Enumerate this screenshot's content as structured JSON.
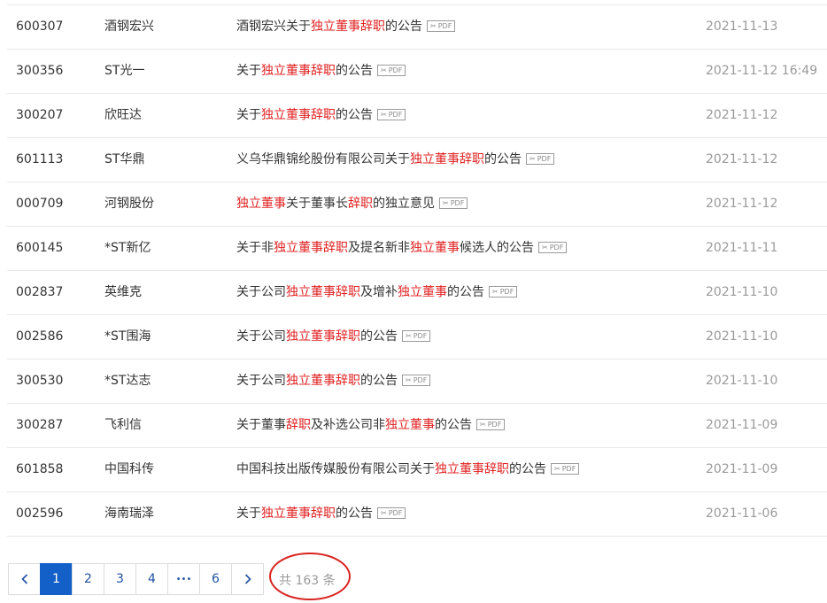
{
  "announcements": [
    {
      "code": "600307",
      "name": "酒钢宏兴",
      "title_parts": [
        {
          "t": "酒钢宏兴关于",
          "h": false
        },
        {
          "t": "独立董事辞职",
          "h": true
        },
        {
          "t": "的公告",
          "h": false
        }
      ],
      "date": "2021-11-13"
    },
    {
      "code": "300356",
      "name": "ST光一",
      "title_parts": [
        {
          "t": "关于",
          "h": false
        },
        {
          "t": "独立董事辞职",
          "h": true
        },
        {
          "t": "的公告",
          "h": false
        }
      ],
      "date": "2021-11-12 16:49"
    },
    {
      "code": "300207",
      "name": "欣旺达",
      "title_parts": [
        {
          "t": "关于",
          "h": false
        },
        {
          "t": "独立董事辞职",
          "h": true
        },
        {
          "t": "的公告",
          "h": false
        }
      ],
      "date": "2021-11-12"
    },
    {
      "code": "601113",
      "name": "ST华鼎",
      "title_parts": [
        {
          "t": "义乌华鼎锦纶股份有限公司关于",
          "h": false
        },
        {
          "t": "独立董事辞职",
          "h": true
        },
        {
          "t": "的公告",
          "h": false
        }
      ],
      "date": "2021-11-12"
    },
    {
      "code": "000709",
      "name": "河钢股份",
      "title_parts": [
        {
          "t": "独立董事",
          "h": true
        },
        {
          "t": "关于董事长",
          "h": false
        },
        {
          "t": "辞职",
          "h": true
        },
        {
          "t": "的独立意见",
          "h": false
        }
      ],
      "date": "2021-11-12"
    },
    {
      "code": "600145",
      "name": "*ST新亿",
      "title_parts": [
        {
          "t": "关于非",
          "h": false
        },
        {
          "t": "独立董事辞职",
          "h": true
        },
        {
          "t": "及提名新非",
          "h": false
        },
        {
          "t": "独立董事",
          "h": true
        },
        {
          "t": "候选人的公告",
          "h": false
        }
      ],
      "date": "2021-11-11"
    },
    {
      "code": "002837",
      "name": "英维克",
      "title_parts": [
        {
          "t": "关于公司",
          "h": false
        },
        {
          "t": "独立董事辞职",
          "h": true
        },
        {
          "t": "及增补",
          "h": false
        },
        {
          "t": "独立董事",
          "h": true
        },
        {
          "t": "的公告",
          "h": false
        }
      ],
      "date": "2021-11-10"
    },
    {
      "code": "002586",
      "name": "*ST围海",
      "title_parts": [
        {
          "t": "关于公司",
          "h": false
        },
        {
          "t": "独立董事辞职",
          "h": true
        },
        {
          "t": "的公告",
          "h": false
        }
      ],
      "date": "2021-11-10"
    },
    {
      "code": "300530",
      "name": "*ST达志",
      "title_parts": [
        {
          "t": "关于公司",
          "h": false
        },
        {
          "t": "独立董事辞职",
          "h": true
        },
        {
          "t": "的公告",
          "h": false
        }
      ],
      "date": "2021-11-10"
    },
    {
      "code": "300287",
      "name": "飞利信",
      "title_parts": [
        {
          "t": "关于董事",
          "h": false
        },
        {
          "t": "辞职",
          "h": true
        },
        {
          "t": "及补选公司非",
          "h": false
        },
        {
          "t": "独立董事",
          "h": true
        },
        {
          "t": "的公告",
          "h": false
        }
      ],
      "date": "2021-11-09"
    },
    {
      "code": "601858",
      "name": "中国科传",
      "title_parts": [
        {
          "t": "中国科技出版传媒股份有限公司关于",
          "h": false
        },
        {
          "t": "独立董事辞职",
          "h": true
        },
        {
          "t": "的公告",
          "h": false
        }
      ],
      "date": "2021-11-09"
    },
    {
      "code": "002596",
      "name": "海南瑞泽",
      "title_parts": [
        {
          "t": "关于",
          "h": false
        },
        {
          "t": "独立董事辞职",
          "h": true
        },
        {
          "t": "的公告",
          "h": false
        }
      ],
      "date": "2021-11-06"
    }
  ],
  "pdf_label": "PDF",
  "pagination": {
    "prev_icon": "chevron-left-icon",
    "next_icon": "chevron-right-icon",
    "pages": [
      "1",
      "2",
      "3",
      "4",
      "•••",
      "6"
    ],
    "current": "1",
    "total_text": "共 163 条"
  },
  "colors": {
    "highlight": "#e02020",
    "active_page": "#1260c8",
    "circle_annotation": "#d9241f",
    "date_text": "#9a9a9a"
  }
}
